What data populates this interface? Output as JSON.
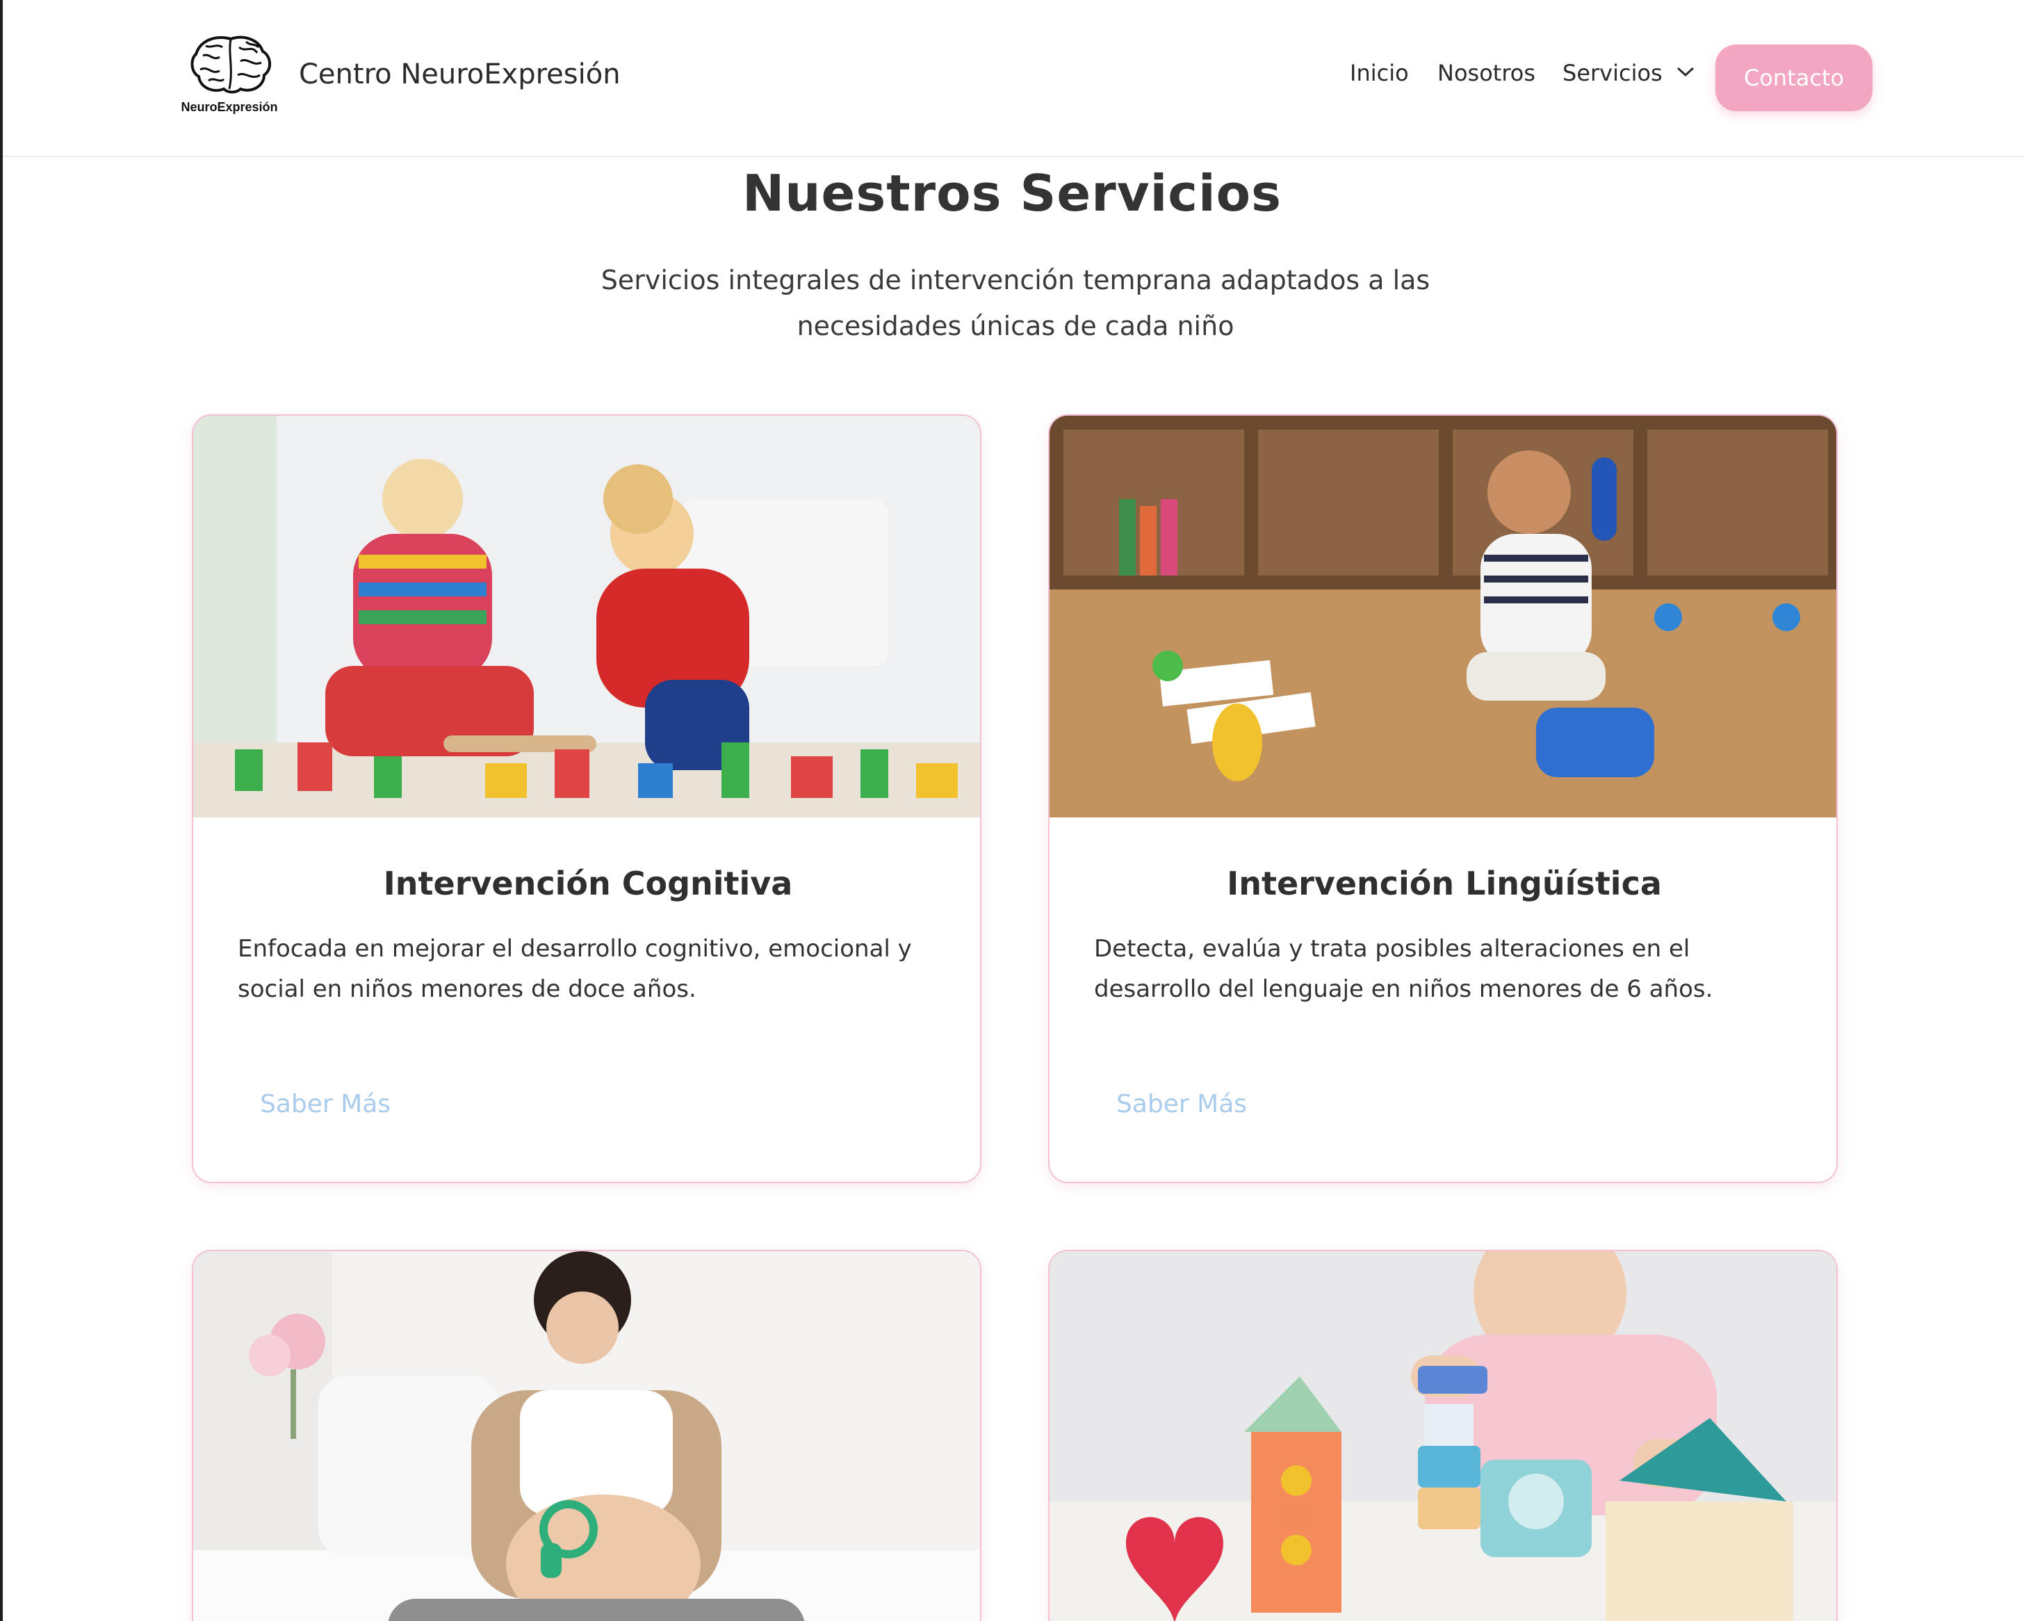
{
  "header": {
    "logo_caption": "NeuroExpresión",
    "brand_name": "Centro NeuroExpresión",
    "nav": {
      "inicio": "Inicio",
      "nosotros": "Nosotros",
      "servicios": "Servicios"
    },
    "contact_label": "Contacto"
  },
  "section": {
    "title": "Nuestros Servicios",
    "subtitle": "Servicios integrales de intervención temprana adaptados a las necesidades únicas de cada niño"
  },
  "cards": [
    {
      "title": "Intervención Cognitiva",
      "description": "Enfocada en mejorar el desarrollo cognitivo, emocional y social en niños menores de doce años.",
      "link": "Saber Más"
    },
    {
      "title": "Intervención Lingüística",
      "description": "Detecta, evalúa y trata posibles alteraciones en el desarrollo del lenguaje en niños menores de 6 años.",
      "link": "Saber Más"
    }
  ],
  "colors": {
    "accent_pink": "#f2a6c1",
    "card_border": "#f4c0d4",
    "link_blue": "#a9ccec"
  },
  "icons": [
    "brain-logo-icon",
    "chevron-down-icon"
  ]
}
